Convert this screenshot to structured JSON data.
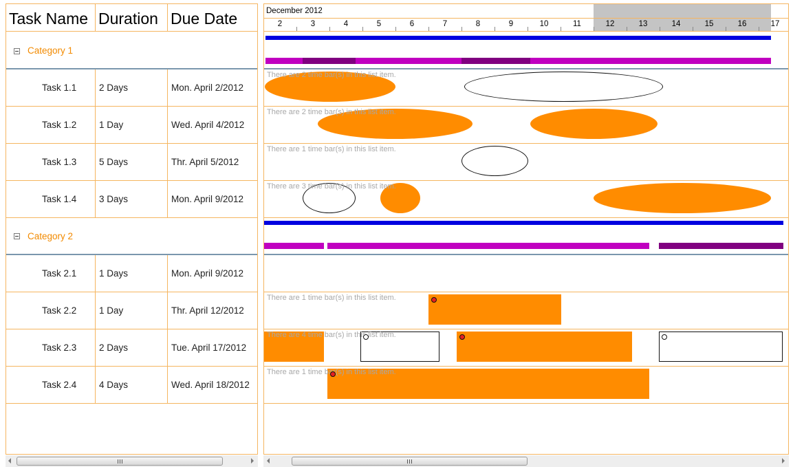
{
  "grid": {
    "headers": {
      "task_name": "Task Name",
      "duration": "Duration",
      "due_date": "Due Date"
    },
    "categories": [
      {
        "label": "Category 1",
        "tasks": [
          {
            "name": "Task 1.1",
            "duration": "2 Days",
            "due": "Mon. April 2/2012"
          },
          {
            "name": "Task 1.2",
            "duration": "1 Day",
            "due": "Wed. April 4/2012"
          },
          {
            "name": "Task 1.3",
            "duration": "5 Days",
            "due": "Thr. April 5/2012"
          },
          {
            "name": "Task 1.4",
            "duration": "3 Days",
            "due": "Mon. April 9/2012"
          }
        ]
      },
      {
        "label": "Category 2",
        "tasks": [
          {
            "name": "Task 2.1",
            "duration": "1 Days",
            "due": "Mon. April 9/2012"
          },
          {
            "name": "Task 2.2",
            "duration": "1 Day",
            "due": "Thr. April 12/2012"
          },
          {
            "name": "Task 2.3",
            "duration": "2 Days",
            "due": "Tue. April 17/2012"
          },
          {
            "name": "Task 2.4",
            "duration": "4 Days",
            "due": "Wed. April 18/2012"
          }
        ]
      }
    ]
  },
  "timeline": {
    "month": "December 2012",
    "days": [
      "2",
      "3",
      "4",
      "5",
      "6",
      "7",
      "8",
      "9",
      "10",
      "11",
      "12",
      "13",
      "14",
      "15",
      "16",
      "17"
    ]
  },
  "chart": {
    "notes": {
      "task_1_1": "There are 2 time bar(s) in this list item.",
      "task_1_2": "There are 2 time bar(s) in this list item.",
      "task_1_3": "There are 1 time bar(s) in this list item.",
      "task_1_4": "There are 3 time bar(s) in this list item.",
      "task_2_2": "There are 1 time bar(s) in this list item.",
      "task_2_3": "There are 4 time bar(s) in this list item.",
      "task_2_4": "There are 1 time bar(s) in this list item."
    }
  },
  "scrollbars": {
    "grip": "|||"
  },
  "colors": {
    "accent_orange": "#ff8c00",
    "category_text": "#f28a00",
    "grid_border": "#f5b55f",
    "summary_blue": "#0000e0",
    "summary_magenta": "#c000c0",
    "summary_purple": "#800080",
    "weekend_gray": "#c4c4c4",
    "category_separator": "#7a96ad"
  }
}
